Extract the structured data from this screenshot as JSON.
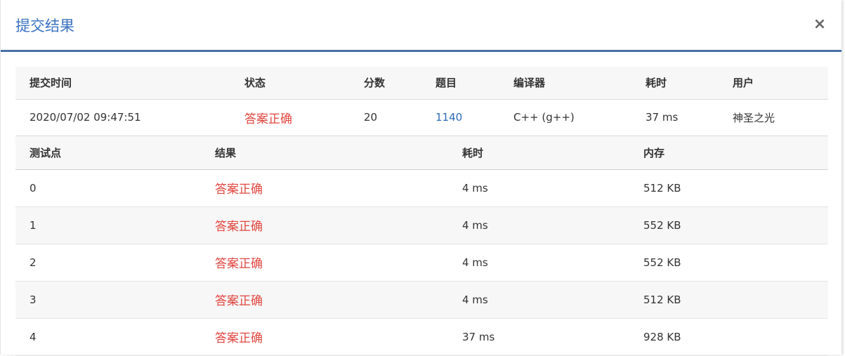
{
  "dialog": {
    "title": "提交结果",
    "close_label": "×"
  },
  "summary": {
    "headers": [
      "提交时间",
      "状态",
      "分数",
      "题目",
      "编译器",
      "耗时",
      "用户"
    ],
    "row": {
      "time": "2020/07/02 09:47:51",
      "status": "答案正确",
      "score": "20",
      "problem": "1140",
      "compiler": "C++ (g++)",
      "duration": "37 ms",
      "user": "神圣之光"
    }
  },
  "tests": {
    "headers": [
      "测试点",
      "结果",
      "耗时",
      "内存"
    ],
    "rows": [
      {
        "id": "0",
        "result": "答案正确",
        "time": "4 ms",
        "memory": "512 KB"
      },
      {
        "id": "1",
        "result": "答案正确",
        "time": "4 ms",
        "memory": "552 KB"
      },
      {
        "id": "2",
        "result": "答案正确",
        "time": "4 ms",
        "memory": "552 KB"
      },
      {
        "id": "3",
        "result": "答案正确",
        "time": "4 ms",
        "memory": "512 KB"
      },
      {
        "id": "4",
        "result": "答案正确",
        "time": "37 ms",
        "memory": "928 KB"
      }
    ]
  },
  "colors": {
    "title": "#3b73c2",
    "accepted": "#e0463f",
    "link": "#2d6ab8",
    "header_border": "#4a6fa5"
  }
}
